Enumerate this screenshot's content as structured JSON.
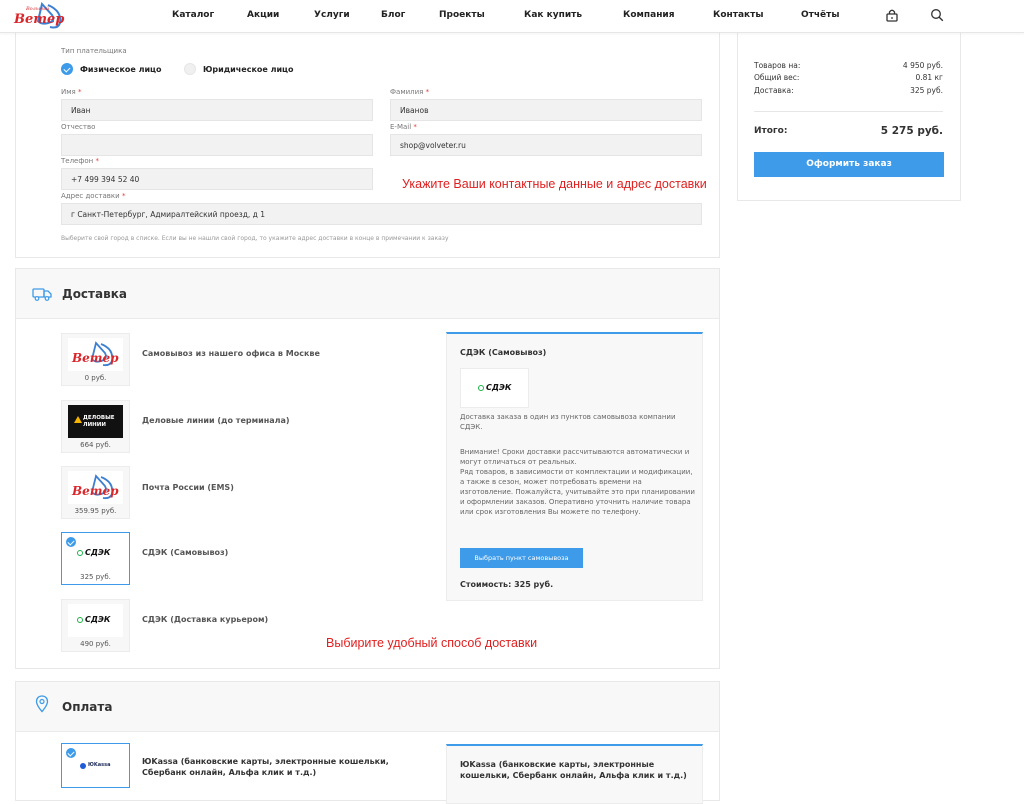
{
  "nav": {
    "logo_text": "Вольный Ветер",
    "items": [
      "Каталог",
      "Акции",
      "Услуги",
      "Блог",
      "Проекты",
      "Как купить",
      "Компания",
      "Контакты",
      "Отчёты"
    ]
  },
  "contact": {
    "payer_type_label": "Тип плательщика",
    "payer_individual": "Физическое лицо",
    "payer_legal": "Юридическое лицо",
    "first_name_label": "Имя",
    "first_name_value": "Иван",
    "last_name_label": "Фамилия",
    "last_name_value": "Иванов",
    "patronymic_label": "Отчество",
    "patronymic_value": "",
    "email_label": "E-Mail",
    "email_value": "shop@volveter.ru",
    "phone_label": "Телефон",
    "phone_value": "+7 499 394 52 40",
    "address_label": "Адрес доставки",
    "address_value": "г Санкт-Петербург, Адмиралтейский проезд, д 1",
    "hint": "Выберите свой город в списке. Если вы не нашли свой город, то укажите адрес доставки в конце в примечании к заказу",
    "annotation": "Укажите Ваши контактные данные и адрес доставки",
    "required_mark": "*"
  },
  "delivery": {
    "title": "Доставка",
    "options": [
      {
        "name": "Самовывоз из нашего офиса в Москве",
        "price": "0 руб.",
        "logo": "volnyi-veter-logo",
        "selected": false
      },
      {
        "name": "Деловые линии (до терминала)",
        "price": "664 руб.",
        "logo": "delovye-linii-logo",
        "selected": false
      },
      {
        "name": "Почта России (EMS)",
        "price": "359.95 руб.",
        "logo": "volnyi-veter-logo",
        "selected": false
      },
      {
        "name": "СДЭК (Самовывоз)",
        "price": "325 руб.",
        "logo": "cdek-logo",
        "selected": true
      },
      {
        "name": "СДЭК (Доставка курьером)",
        "price": "490 руб.",
        "logo": "cdek-logo",
        "selected": false
      }
    ],
    "delovye_logo_text": "ДЕЛОВЫЕ ЛИНИИ",
    "cdek_logo_text": "СДЭК",
    "detail": {
      "title": "СДЭК (Самовывоз)",
      "desc1": "Доставка заказа в один из пунктов самовывоза компании СДЭК.",
      "desc2": "Внимание! Сроки доставки рассчитываются автоматически и могут отличаться от реальных.",
      "desc3": "Ряд товаров, в зависимости от комплектации и модификации, а также в сезон, может потребовать времени на изготовление. Пожалуйста, учитывайте это при планировании и оформлении заказов. Оперативно уточнить наличие товара или срок изготовления Вы можете по телефону.",
      "button": "Выбрать пункт самовывоза",
      "cost": "Стоимость: 325 руб."
    },
    "annotation": "Выбирите удобный способ доставки"
  },
  "payment": {
    "title": "Оплата",
    "option_name": "ЮKassa (банковские карты, электронные кошельки, Сбербанк онлайн, Альфа клик и т.д.)",
    "detail_title": "ЮKassa (банковские карты, электронные кошельки, Сбербанк онлайн, Альфа клик и т.д.)",
    "logo_text": "ЮKassa"
  },
  "summary": {
    "goods_label": "Товаров на:",
    "goods_value": "4 950 руб.",
    "weight_label": "Общий вес:",
    "weight_value": "0.81 кг",
    "delivery_label": "Доставка:",
    "delivery_value": "325 руб.",
    "total_label": "Итого:",
    "total_value": "5 275 руб.",
    "order_button": "Оформить заказ"
  },
  "colors": {
    "accent": "#3d9be9",
    "annotation": "#e02020",
    "required": "#e53935"
  }
}
